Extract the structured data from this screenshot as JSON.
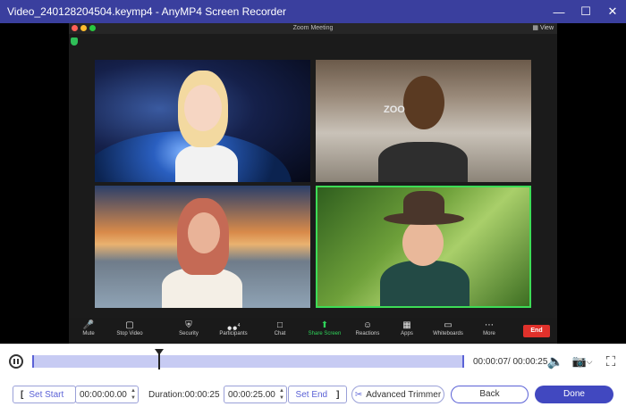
{
  "window": {
    "title": "Video_240128204504.keymp4 - AnyMP4 Screen Recorder",
    "minimize_icon": "minimize-icon",
    "maximize_icon": "maximize-icon",
    "close_icon": "close-icon",
    "bg_color": "#3a3f9e"
  },
  "zoom": {
    "title": "Zoom Meeting",
    "view_label": "View",
    "toolbar": [
      {
        "label": "Mute",
        "icon": "microphone-icon"
      },
      {
        "label": "Stop Video",
        "icon": "camera-icon"
      },
      {
        "label": "Security",
        "icon": "shield-icon"
      },
      {
        "label": "Participants",
        "icon": "people-icon"
      },
      {
        "label": "Chat",
        "icon": "chat-icon"
      },
      {
        "label": "Share Screen",
        "icon": "share-icon"
      },
      {
        "label": "Reactions",
        "icon": "smile-icon"
      },
      {
        "label": "Apps",
        "icon": "apps-icon"
      },
      {
        "label": "Whiteboards",
        "icon": "whiteboard-icon"
      },
      {
        "label": "More",
        "icon": "more-icon"
      }
    ],
    "participant_count": "4",
    "end_label": "End",
    "active_speaker_color": "#3ddc56"
  },
  "player": {
    "time": "00:00:07/ 00:00:25",
    "accent": "#5b62d6"
  },
  "trim": {
    "set_start_label": "Set Start",
    "start_time": "00:00:00.00",
    "duration_label": "Duration:00:00:25",
    "end_time": "00:00:25.00",
    "set_end_label": "Set End",
    "advanced_trimmer_label": "Advanced Trimmer",
    "back_label": "Back",
    "done_label": "Done"
  }
}
